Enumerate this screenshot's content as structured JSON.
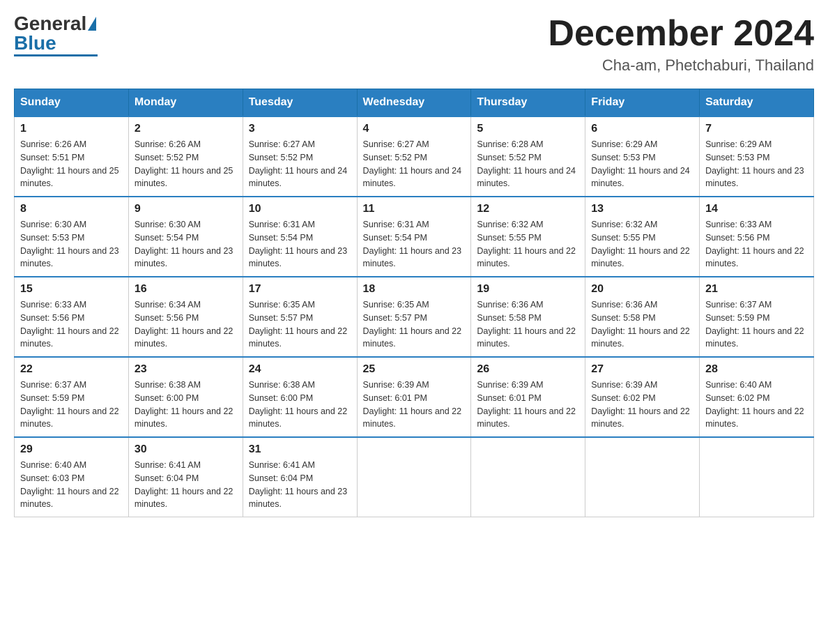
{
  "header": {
    "logo_general": "General",
    "logo_blue": "Blue",
    "month_title": "December 2024",
    "location": "Cha-am, Phetchaburi, Thailand"
  },
  "days_of_week": [
    "Sunday",
    "Monday",
    "Tuesday",
    "Wednesday",
    "Thursday",
    "Friday",
    "Saturday"
  ],
  "weeks": [
    [
      {
        "day": "1",
        "sunrise": "6:26 AM",
        "sunset": "5:51 PM",
        "daylight": "11 hours and 25 minutes."
      },
      {
        "day": "2",
        "sunrise": "6:26 AM",
        "sunset": "5:52 PM",
        "daylight": "11 hours and 25 minutes."
      },
      {
        "day": "3",
        "sunrise": "6:27 AM",
        "sunset": "5:52 PM",
        "daylight": "11 hours and 24 minutes."
      },
      {
        "day": "4",
        "sunrise": "6:27 AM",
        "sunset": "5:52 PM",
        "daylight": "11 hours and 24 minutes."
      },
      {
        "day": "5",
        "sunrise": "6:28 AM",
        "sunset": "5:52 PM",
        "daylight": "11 hours and 24 minutes."
      },
      {
        "day": "6",
        "sunrise": "6:29 AM",
        "sunset": "5:53 PM",
        "daylight": "11 hours and 24 minutes."
      },
      {
        "day": "7",
        "sunrise": "6:29 AM",
        "sunset": "5:53 PM",
        "daylight": "11 hours and 23 minutes."
      }
    ],
    [
      {
        "day": "8",
        "sunrise": "6:30 AM",
        "sunset": "5:53 PM",
        "daylight": "11 hours and 23 minutes."
      },
      {
        "day": "9",
        "sunrise": "6:30 AM",
        "sunset": "5:54 PM",
        "daylight": "11 hours and 23 minutes."
      },
      {
        "day": "10",
        "sunrise": "6:31 AM",
        "sunset": "5:54 PM",
        "daylight": "11 hours and 23 minutes."
      },
      {
        "day": "11",
        "sunrise": "6:31 AM",
        "sunset": "5:54 PM",
        "daylight": "11 hours and 23 minutes."
      },
      {
        "day": "12",
        "sunrise": "6:32 AM",
        "sunset": "5:55 PM",
        "daylight": "11 hours and 22 minutes."
      },
      {
        "day": "13",
        "sunrise": "6:32 AM",
        "sunset": "5:55 PM",
        "daylight": "11 hours and 22 minutes."
      },
      {
        "day": "14",
        "sunrise": "6:33 AM",
        "sunset": "5:56 PM",
        "daylight": "11 hours and 22 minutes."
      }
    ],
    [
      {
        "day": "15",
        "sunrise": "6:33 AM",
        "sunset": "5:56 PM",
        "daylight": "11 hours and 22 minutes."
      },
      {
        "day": "16",
        "sunrise": "6:34 AM",
        "sunset": "5:56 PM",
        "daylight": "11 hours and 22 minutes."
      },
      {
        "day": "17",
        "sunrise": "6:35 AM",
        "sunset": "5:57 PM",
        "daylight": "11 hours and 22 minutes."
      },
      {
        "day": "18",
        "sunrise": "6:35 AM",
        "sunset": "5:57 PM",
        "daylight": "11 hours and 22 minutes."
      },
      {
        "day": "19",
        "sunrise": "6:36 AM",
        "sunset": "5:58 PM",
        "daylight": "11 hours and 22 minutes."
      },
      {
        "day": "20",
        "sunrise": "6:36 AM",
        "sunset": "5:58 PM",
        "daylight": "11 hours and 22 minutes."
      },
      {
        "day": "21",
        "sunrise": "6:37 AM",
        "sunset": "5:59 PM",
        "daylight": "11 hours and 22 minutes."
      }
    ],
    [
      {
        "day": "22",
        "sunrise": "6:37 AM",
        "sunset": "5:59 PM",
        "daylight": "11 hours and 22 minutes."
      },
      {
        "day": "23",
        "sunrise": "6:38 AM",
        "sunset": "6:00 PM",
        "daylight": "11 hours and 22 minutes."
      },
      {
        "day": "24",
        "sunrise": "6:38 AM",
        "sunset": "6:00 PM",
        "daylight": "11 hours and 22 minutes."
      },
      {
        "day": "25",
        "sunrise": "6:39 AM",
        "sunset": "6:01 PM",
        "daylight": "11 hours and 22 minutes."
      },
      {
        "day": "26",
        "sunrise": "6:39 AM",
        "sunset": "6:01 PM",
        "daylight": "11 hours and 22 minutes."
      },
      {
        "day": "27",
        "sunrise": "6:39 AM",
        "sunset": "6:02 PM",
        "daylight": "11 hours and 22 minutes."
      },
      {
        "day": "28",
        "sunrise": "6:40 AM",
        "sunset": "6:02 PM",
        "daylight": "11 hours and 22 minutes."
      }
    ],
    [
      {
        "day": "29",
        "sunrise": "6:40 AM",
        "sunset": "6:03 PM",
        "daylight": "11 hours and 22 minutes."
      },
      {
        "day": "30",
        "sunrise": "6:41 AM",
        "sunset": "6:04 PM",
        "daylight": "11 hours and 22 minutes."
      },
      {
        "day": "31",
        "sunrise": "6:41 AM",
        "sunset": "6:04 PM",
        "daylight": "11 hours and 23 minutes."
      },
      null,
      null,
      null,
      null
    ]
  ]
}
